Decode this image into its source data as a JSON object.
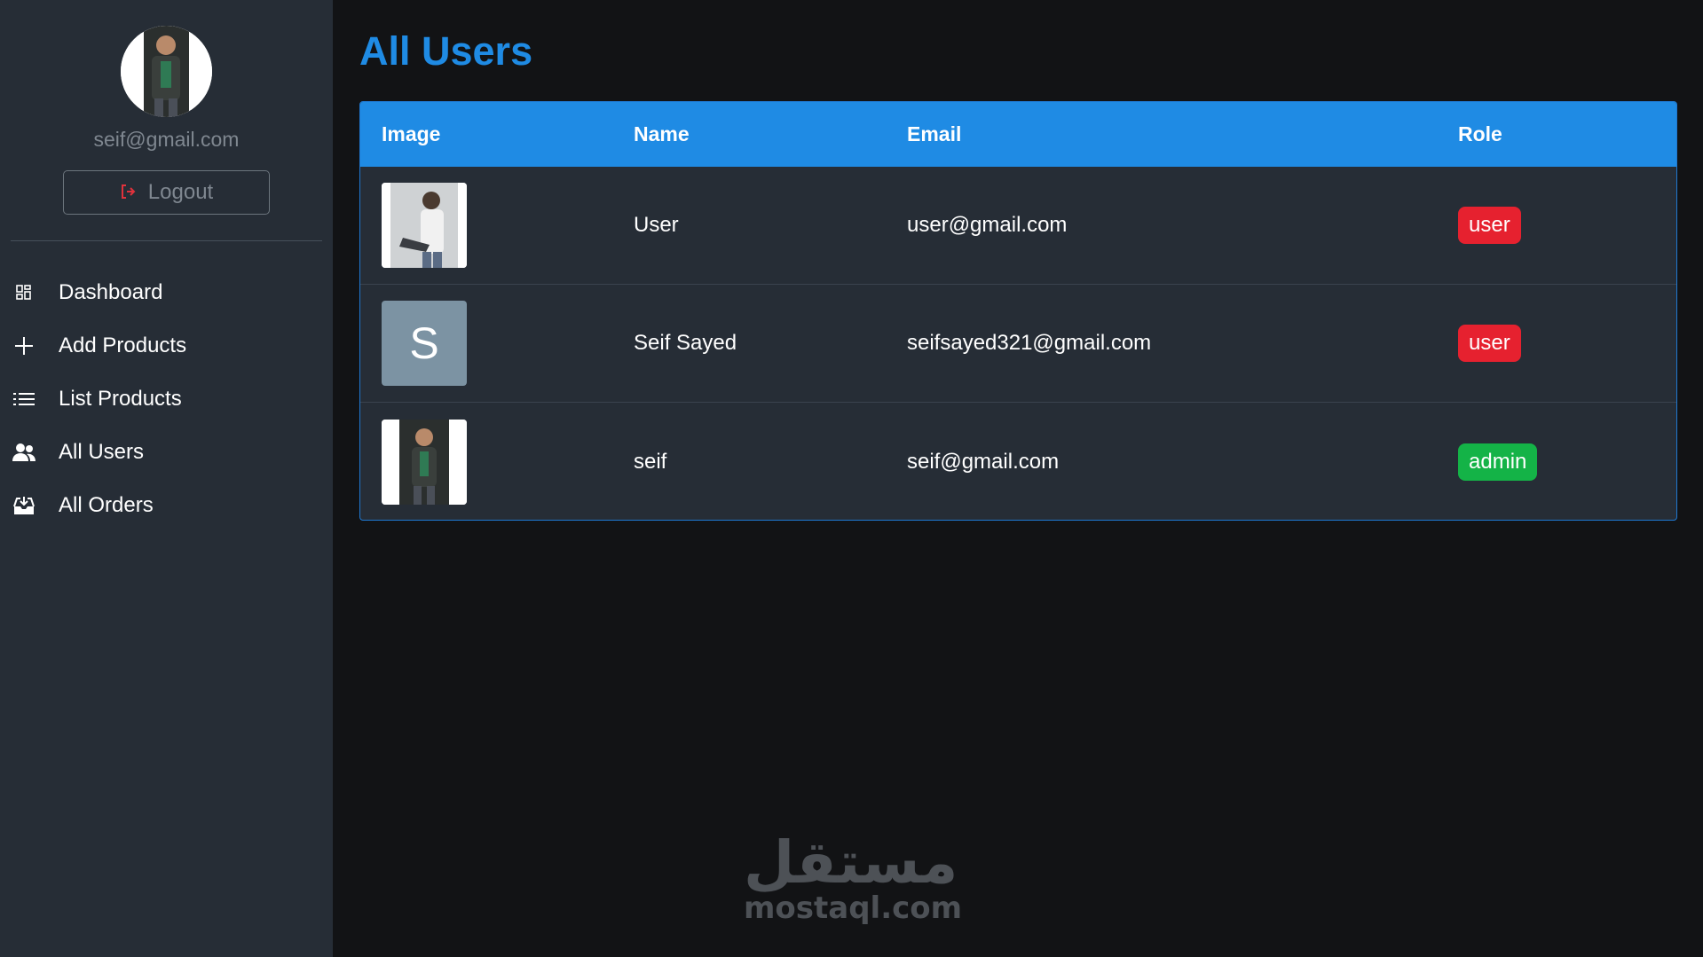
{
  "sidebar": {
    "email": "seif@gmail.com",
    "logout_label": "Logout",
    "items": [
      {
        "label": "Dashboard",
        "icon": "dashboard-icon"
      },
      {
        "label": "Add Products",
        "icon": "plus-icon"
      },
      {
        "label": "List Products",
        "icon": "list-icon"
      },
      {
        "label": "All Users",
        "icon": "users-icon"
      },
      {
        "label": "All Orders",
        "icon": "inbox-icon"
      }
    ]
  },
  "main": {
    "title": "All Users",
    "headers": {
      "image": "Image",
      "name": "Name",
      "email": "Email",
      "role": "Role"
    },
    "rows": [
      {
        "name": "User",
        "email": "user@gmail.com",
        "role": "user",
        "image": "photo"
      },
      {
        "name": "Seif Sayed",
        "email": "seifsayed321@gmail.com",
        "role": "user",
        "image_letter": "S"
      },
      {
        "name": "seif",
        "email": "seif@gmail.com",
        "role": "admin",
        "image": "photo"
      }
    ]
  },
  "colors": {
    "accent": "#1f8be4",
    "sidebar_bg": "#262d36",
    "page_bg": "#121315",
    "role_user": "#e6212f",
    "role_admin": "#14b347"
  },
  "watermark": {
    "arabic": "مستقل",
    "latin": "mostaql.com"
  }
}
